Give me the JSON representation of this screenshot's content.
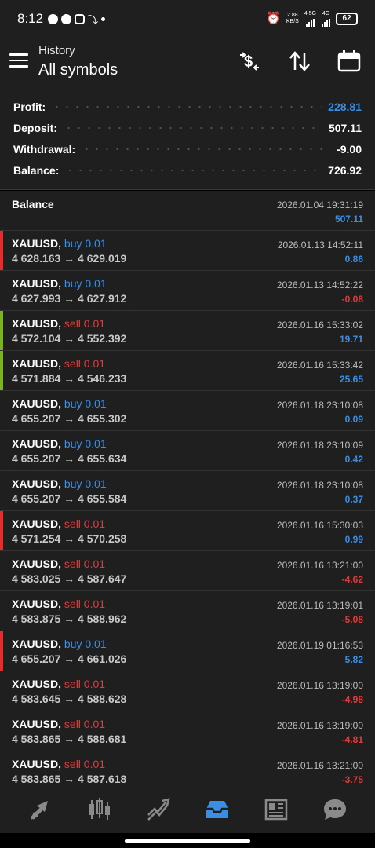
{
  "status_bar": {
    "time": "8:12",
    "net_speed": "2.88",
    "net_unit": "KB/S",
    "net_type_1": "4.5G",
    "net_type_2": "4G",
    "battery": "62"
  },
  "header": {
    "subtitle": "History",
    "title": "All symbols",
    "icons": [
      "currency-swap-icon",
      "sort-icon",
      "calendar-icon"
    ]
  },
  "summary": [
    {
      "label": "Profit:",
      "value": "228.81",
      "color": "#3a8ee6"
    },
    {
      "label": "Deposit:",
      "value": "507.11",
      "color": "#ffffff"
    },
    {
      "label": "Withdrawal:",
      "value": "-9.00",
      "color": "#ffffff"
    },
    {
      "label": "Balance:",
      "value": "726.92",
      "color": "#ffffff"
    }
  ],
  "balance_row": {
    "label": "Balance",
    "time": "2026.01.04 19:31:19",
    "amount": "507.11"
  },
  "deals": [
    {
      "symbol": "XAUUSD,",
      "side": "buy 0.01",
      "side_type": "buy",
      "prices": "4 628.163 → 4 629.019",
      "time": "2026.01.13 14:52:11",
      "profit": "0.86",
      "profit_sign": "pos",
      "bar_color": "#e52b2b"
    },
    {
      "symbol": "XAUUSD,",
      "side": "buy 0.01",
      "side_type": "buy",
      "prices": "4 627.993 → 4 627.912",
      "time": "2026.01.13 14:52:22",
      "profit": "-0.08",
      "profit_sign": "neg",
      "bar_color": ""
    },
    {
      "symbol": "XAUUSD,",
      "side": "sell 0.01",
      "side_type": "sell",
      "prices": "4 572.104 → 4 552.392",
      "time": "2026.01.16 15:33:02",
      "profit": "19.71",
      "profit_sign": "pos",
      "bar_color": "#7ab51d"
    },
    {
      "symbol": "XAUUSD,",
      "side": "sell 0.01",
      "side_type": "sell",
      "prices": "4 571.884 → 4 546.233",
      "time": "2026.01.16 15:33:42",
      "profit": "25.65",
      "profit_sign": "pos",
      "bar_color": "#7ab51d"
    },
    {
      "symbol": "XAUUSD,",
      "side": "buy 0.01",
      "side_type": "buy",
      "prices": "4 655.207 → 4 655.302",
      "time": "2026.01.18 23:10:08",
      "profit": "0.09",
      "profit_sign": "pos",
      "bar_color": ""
    },
    {
      "symbol": "XAUUSD,",
      "side": "buy 0.01",
      "side_type": "buy",
      "prices": "4 655.207 → 4 655.634",
      "time": "2026.01.18 23:10:09",
      "profit": "0.42",
      "profit_sign": "pos",
      "bar_color": ""
    },
    {
      "symbol": "XAUUSD,",
      "side": "buy 0.01",
      "side_type": "buy",
      "prices": "4 655.207 → 4 655.584",
      "time": "2026.01.18 23:10:08",
      "profit": "0.37",
      "profit_sign": "pos",
      "bar_color": ""
    },
    {
      "symbol": "XAUUSD,",
      "side": "sell 0.01",
      "side_type": "sell",
      "prices": "4 571.254 → 4 570.258",
      "time": "2026.01.16 15:30:03",
      "profit": "0.99",
      "profit_sign": "pos",
      "bar_color": "#e52b2b"
    },
    {
      "symbol": "XAUUSD,",
      "side": "sell 0.01",
      "side_type": "sell",
      "prices": "4 583.025 → 4 587.647",
      "time": "2026.01.16 13:21:00",
      "profit": "-4.62",
      "profit_sign": "neg",
      "bar_color": ""
    },
    {
      "symbol": "XAUUSD,",
      "side": "sell 0.01",
      "side_type": "sell",
      "prices": "4 583.875 → 4 588.962",
      "time": "2026.01.16 13:19:01",
      "profit": "-5.08",
      "profit_sign": "neg",
      "bar_color": ""
    },
    {
      "symbol": "XAUUSD,",
      "side": "buy 0.01",
      "side_type": "buy",
      "prices": "4 655.207 → 4 661.026",
      "time": "2026.01.19 01:16:53",
      "profit": "5.82",
      "profit_sign": "pos",
      "bar_color": "#e52b2b"
    },
    {
      "symbol": "XAUUSD,",
      "side": "sell 0.01",
      "side_type": "sell",
      "prices": "4 583.645 → 4 588.628",
      "time": "2026.01.16 13:19:00",
      "profit": "-4.98",
      "profit_sign": "neg",
      "bar_color": ""
    },
    {
      "symbol": "XAUUSD,",
      "side": "sell 0.01",
      "side_type": "sell",
      "prices": "4 583.865 → 4 588.681",
      "time": "2026.01.16 13:19:00",
      "profit": "-4.81",
      "profit_sign": "neg",
      "bar_color": ""
    },
    {
      "symbol": "XAUUSD,",
      "side": "sell 0.01",
      "side_type": "sell",
      "prices": "4 583.865 → 4 587.618",
      "time": "2026.01.16 13:21:00",
      "profit": "-3.75",
      "profit_sign": "neg",
      "bar_color": ""
    }
  ],
  "bottom_nav": [
    {
      "name": "quotes-icon",
      "active": false
    },
    {
      "name": "chart-icon",
      "active": false
    },
    {
      "name": "trade-icon",
      "active": false
    },
    {
      "name": "history-icon",
      "active": true
    },
    {
      "name": "news-icon",
      "active": false
    },
    {
      "name": "chat-icon",
      "active": false
    }
  ],
  "colors": {
    "accent_blue": "#3a8ee6",
    "sell_red": "#e23a3a",
    "background": "#1f1f1f",
    "nav_inactive": "#8a8a8a"
  }
}
